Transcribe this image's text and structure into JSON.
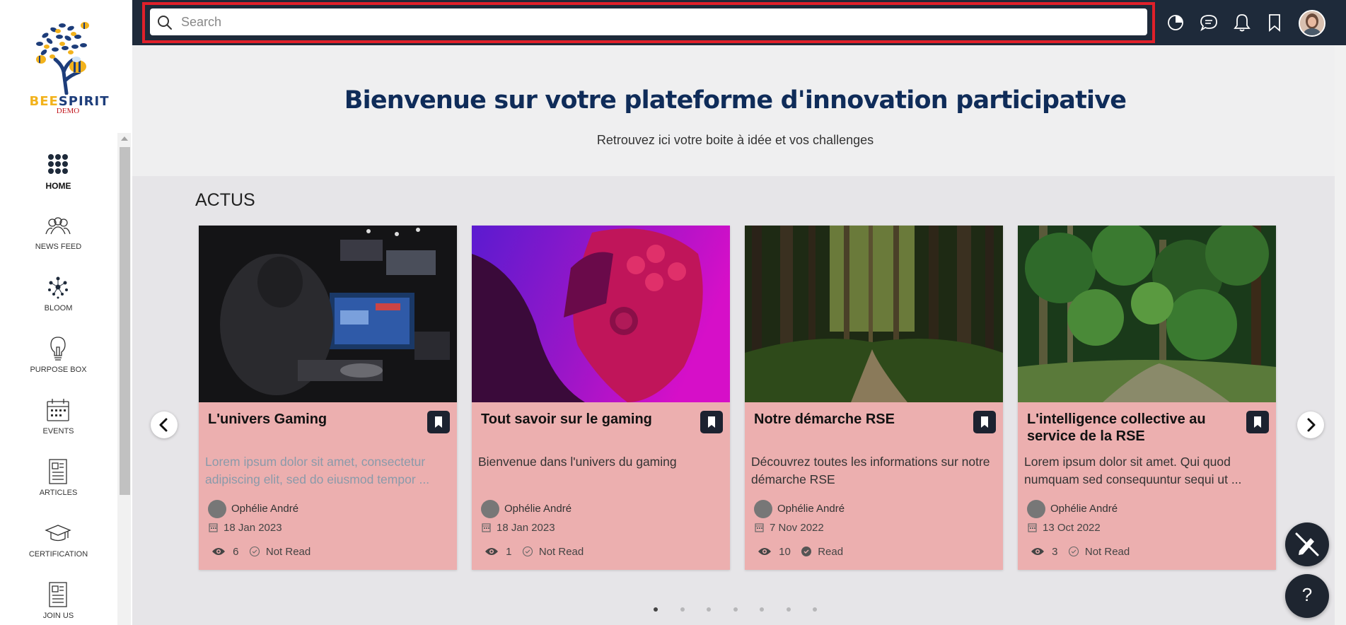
{
  "logo": {
    "brand_a": "BEE",
    "brand_b": "SPIRIT",
    "sub": "DEMO"
  },
  "sidebar": {
    "items": [
      {
        "label": "HOME",
        "icon": "grid-dots-icon"
      },
      {
        "label": "NEWS FEED",
        "icon": "people-icon"
      },
      {
        "label": "BLOOM",
        "icon": "bloom-icon"
      },
      {
        "label": "PURPOSE BOX",
        "icon": "lightbulb-icon"
      },
      {
        "label": "EVENTS",
        "icon": "calendar-icon"
      },
      {
        "label": "ARTICLES",
        "icon": "document-icon"
      },
      {
        "label": "CERTIFICATION",
        "icon": "graduation-cap-icon"
      },
      {
        "label": "JOIN US",
        "icon": "document-icon"
      }
    ]
  },
  "search": {
    "placeholder": "Search"
  },
  "topbar": {
    "icons": [
      "pie-chart-icon",
      "chat-icon",
      "bell-icon",
      "bookmark-icon",
      "avatar"
    ]
  },
  "main": {
    "title": "Bienvenue sur votre plateforme d'innovation participative",
    "subtitle": "Retrouvez ici votre boite à idée et vos challenges",
    "section_title": "ACTUS"
  },
  "cards": [
    {
      "title": "L'univers Gaming",
      "desc": "Lorem ipsum dolor sit amet, consectetur adipiscing elit, sed do eiusmod tempor ...",
      "author": "Ophélie André",
      "date": "18 Jan 2023",
      "views": "6",
      "status": "Not Read"
    },
    {
      "title": "Tout savoir sur le gaming",
      "desc": "Bienvenue dans l'univers du gaming",
      "author": "Ophélie André",
      "date": "18 Jan 2023",
      "views": "1",
      "status": "Not Read"
    },
    {
      "title": "Notre démarche RSE",
      "desc": "Découvrez toutes les informations sur notre démarche RSE",
      "author": "Ophélie André",
      "date": "7 Nov 2022",
      "views": "10",
      "status": "Read"
    },
    {
      "title": "L'intelligence collective au service de la RSE",
      "desc": "Lorem ipsum dolor sit amet. Qui quod numquam sed consequuntur sequi ut ...",
      "author": "Ophélie André",
      "date": "13 Oct 2022",
      "views": "3",
      "status": "Not Read"
    }
  ],
  "carousel": {
    "dot_count": 7,
    "active_dot": 1
  },
  "fab": {
    "help_label": "?"
  },
  "colors": {
    "topbar": "#1e2a3a",
    "title": "#0f2c59",
    "card": "#ecafaf",
    "highlight": "#e0202a"
  }
}
